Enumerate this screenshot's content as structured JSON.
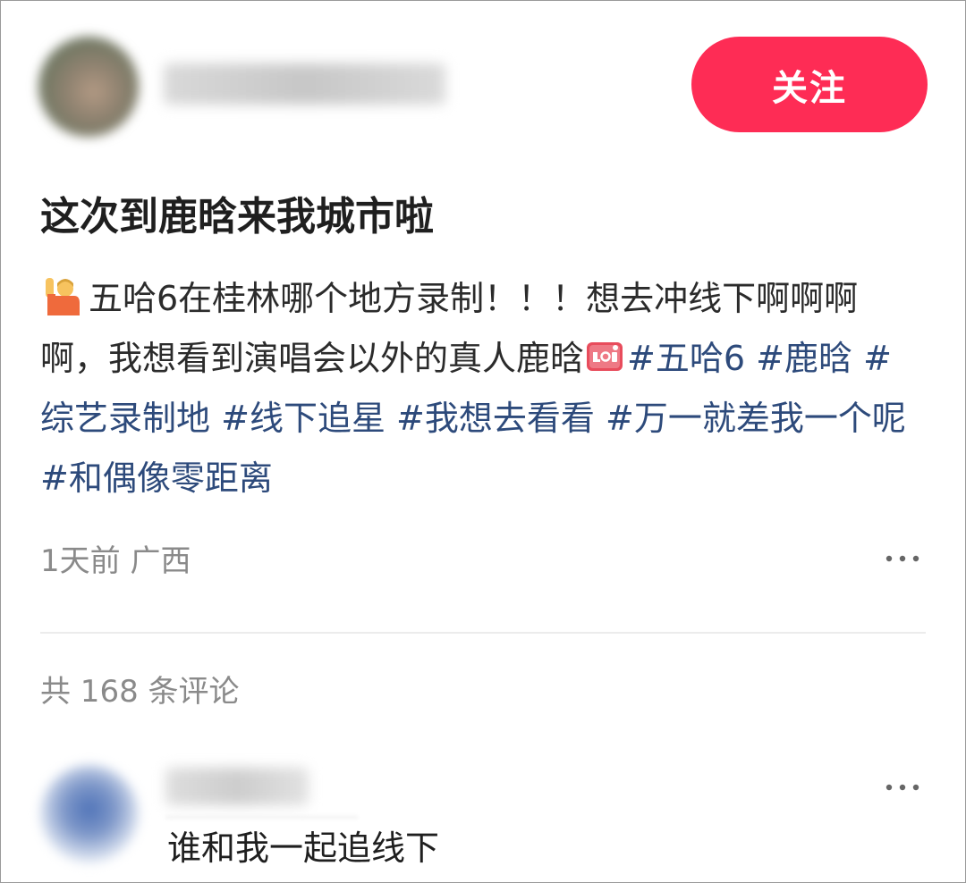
{
  "post": {
    "follow_label": "关注",
    "title": "这次到鹿晗来我城市啦",
    "body_intro": "五哈6在桂林哪个地方录制！！！想去冲线下啊啊啊啊，我想看到演唱会以外的真人鹿晗",
    "hashtags": [
      "#五哈6",
      "#鹿晗",
      "#综艺录制地",
      "#线下追星",
      "#我想去看看",
      "#万一就差我一个呢",
      "#和偶像零距离"
    ],
    "time": "1天前",
    "location": "广西",
    "more_label": "更多"
  },
  "comments": {
    "count_text": "共 168 条评论",
    "items": [
      {
        "text": "谁和我一起追线下"
      }
    ]
  },
  "colors": {
    "accent": "#fe2c55",
    "hashtag": "#2d4a7b",
    "meta": "#8a8a8a",
    "text": "#2b2b2b"
  },
  "icons": {
    "emoji_before_text": "person-raising-hand-icon",
    "emoji_after_text": "live-badge-icon",
    "more": "more-dots-icon"
  }
}
